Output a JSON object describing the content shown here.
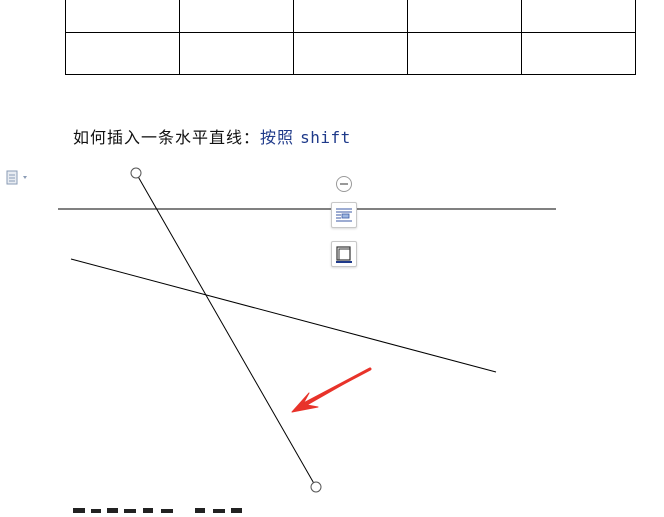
{
  "paragraph": {
    "text_prefix": "如何插入一条水平直线：",
    "text_highlight": "按照",
    "text_key": "shift"
  },
  "table": {
    "rows": 2,
    "cols": 5
  },
  "icons": {
    "paragraph_marker": "paragraph-marker-icon",
    "collapse": "minus-circle-icon",
    "layout_options": "text-wrap-icon",
    "shape_style": "shape-frame-icon",
    "arrow": "red-arrow-annotation"
  },
  "colors": {
    "arrow": "#e8332a",
    "highlight_text": "#1f3a8a",
    "line": "#000000"
  }
}
